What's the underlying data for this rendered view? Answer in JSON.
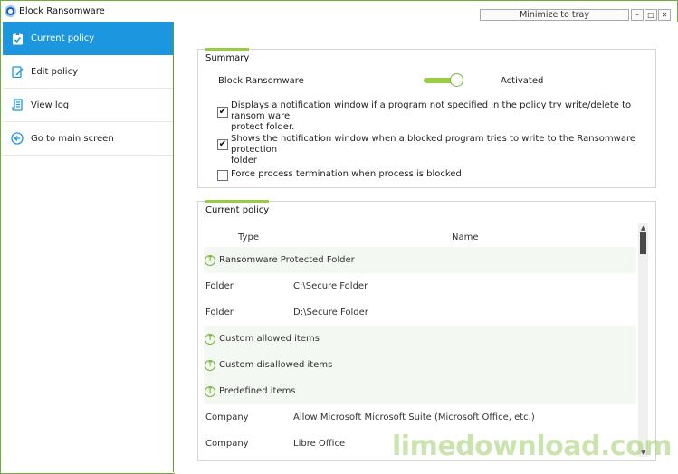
{
  "window": {
    "title": "Block Ransomware",
    "minimize_to_tray": "Minimize to tray",
    "btn_minimize": "–",
    "btn_maximize": "□",
    "btn_close": "✕"
  },
  "sidebar": {
    "items": [
      {
        "label": "Current policy",
        "icon": "clipboard-check-icon",
        "active": true
      },
      {
        "label": "Edit policy",
        "icon": "edit-icon",
        "active": false
      },
      {
        "label": "View log",
        "icon": "log-icon",
        "active": false
      },
      {
        "label": "Go to main screen",
        "icon": "arrow-left-circle-icon",
        "active": false
      }
    ]
  },
  "summary": {
    "tab_label": "Summary",
    "feature_label": "Block Ransomware",
    "status": "Activated",
    "toggle_on": true,
    "options": [
      {
        "checked": true,
        "line1": "Displays a notification window if a program not specified in the policy try write/delete to ransom ware",
        "line2": "protect folder."
      },
      {
        "checked": true,
        "line1": "Shows the notification window when a blocked program tries to write to the Ransomware protection",
        "line2": "folder"
      },
      {
        "checked": false,
        "line1": "Force process termination when process is blocked",
        "line2": ""
      }
    ]
  },
  "policy": {
    "tab_label": "Current policy",
    "columns": {
      "type": "Type",
      "name": "Name"
    },
    "rows": [
      {
        "kind": "group",
        "label": "Ransomware Protected Folder"
      },
      {
        "kind": "item",
        "type": "Folder",
        "name": "C:\\Secure Folder"
      },
      {
        "kind": "item",
        "type": "Folder",
        "name": "D:\\Secure Folder"
      },
      {
        "kind": "group",
        "label": "Custom allowed items"
      },
      {
        "kind": "group",
        "label": "Custom disallowed items"
      },
      {
        "kind": "group",
        "label": "Predefined items"
      },
      {
        "kind": "item",
        "type": "Company",
        "name": "Allow Microsoft Microsoft Suite (Microsoft Office, etc.)"
      },
      {
        "kind": "item",
        "type": "Company",
        "name": "Libre Office"
      }
    ]
  },
  "watermark": "limedownload.com",
  "colors": {
    "accent_blue": "#1c96df",
    "accent_green": "#9acd45",
    "border_green": "#6fae3a"
  }
}
